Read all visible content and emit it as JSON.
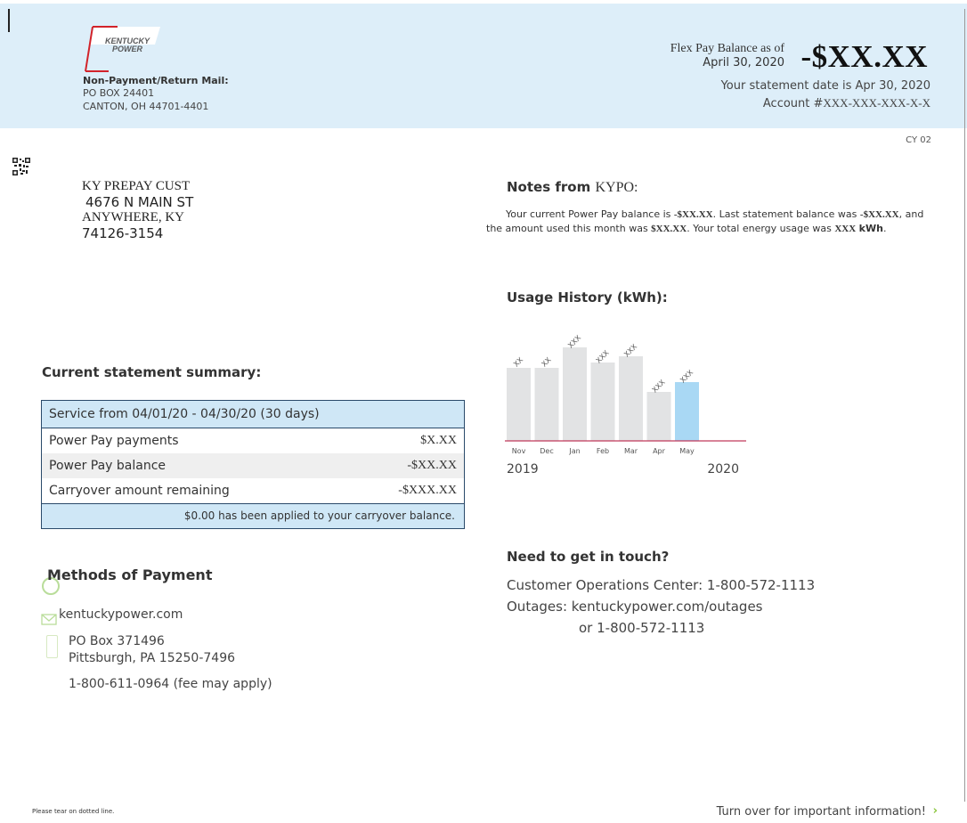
{
  "header": {
    "logo_line1": "KENTUCKY",
    "logo_line2": "POWER",
    "return_title": "Non-Payment/Return Mail:",
    "return_line1": "PO BOX 24401",
    "return_line2": "CANTON, OH 44701-4401",
    "flex_label_line1": "Flex Pay Balance as of",
    "flex_label_line2": "April 30, 2020",
    "flex_amount": "-$XX.XX",
    "statement_date": "Your statement date is Apr 30, 2020",
    "account_prefix": "Account #",
    "account_number": "XXX-XXX-XXX-X-X",
    "cy_code": "CY 02"
  },
  "customer": {
    "name": "KY PREPAY CUST",
    "street": "4676 N MAIN ST",
    "city": "ANYWHERE, KY",
    "zip": "74126-3154"
  },
  "notes": {
    "title_prefix": "Notes from",
    "title_name": "KYPO:",
    "t1": "Your current Power Pay balance is ",
    "b1": "-$XX.XX",
    "t2": ". Last statement balance was ",
    "b2": "-$XX.XX",
    "t3": ", and the amount used this month was ",
    "b3": "$XX.XX",
    "t4": ". Your total energy usage was ",
    "b4": "XXX",
    "b5": "kWh",
    "t5": "."
  },
  "usage": {
    "title": "Usage History (kWh):"
  },
  "chart_data": {
    "type": "bar",
    "categories": [
      "Nov",
      "Dec",
      "Jan",
      "Feb",
      "Mar",
      "Apr",
      "May"
    ],
    "values": [
      82,
      82,
      105,
      88,
      95,
      55,
      66
    ],
    "data_labels": [
      "XX",
      "XX",
      "XXX",
      "XXX",
      "XXX",
      "XXX",
      "XXX"
    ],
    "year_start": "2019",
    "year_end": "2020",
    "highlight_index": 6,
    "bar_color": "#e2e3e4",
    "highlight_color": "#a9d8f4",
    "baseline_color": "#c0395a",
    "ylim": [
      0,
      110
    ]
  },
  "summary": {
    "title": "Current statement summary:",
    "service": "Service from 04/01/20 - 04/30/20 (30 days)",
    "rows": [
      {
        "label": "Power Pay payments",
        "value": "$X.XX"
      },
      {
        "label": "Power Pay balance",
        "value": "-$XX.XX"
      },
      {
        "label": "Carryover amount remaining",
        "value": "-$XXX.XX"
      }
    ],
    "footer": "$0.00 has been applied to your carryover balance."
  },
  "payment": {
    "title": "Methods of Payment",
    "web": "kentuckypower.com",
    "mail_line1": "PO Box 371496",
    "mail_line2": "Pittsburgh, PA 15250-7496",
    "phone": "1-800-611-0964 (fee may apply)"
  },
  "contact": {
    "title": "Need to get in touch?",
    "line1": "Customer Operations Center: 1-800-572-1113",
    "line2": "Outages: kentuckypower.com/outages",
    "line3": "or 1-800-572-1113"
  },
  "footer": {
    "tear": "Please tear on dotted line.",
    "turn": "Turn over for important information!",
    "arrow": "›"
  },
  "colors": {
    "header_bg": "#ddeef9",
    "logo_red": "#d2232a",
    "summary_blue": "#cfe7f6",
    "accent_green": "#8cc63f"
  }
}
